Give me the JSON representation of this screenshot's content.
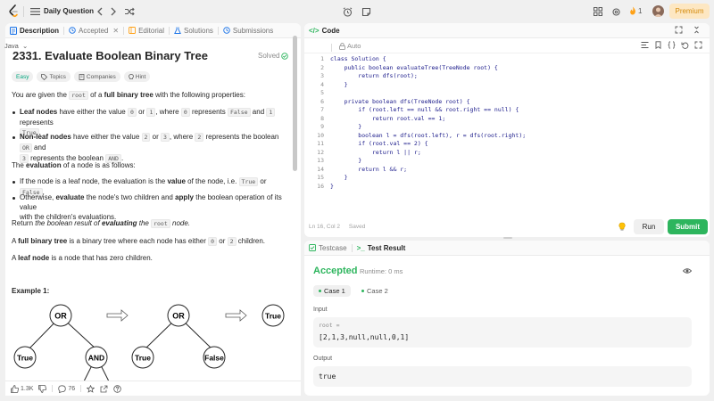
{
  "topbar": {
    "title": "Daily Question",
    "streak_count": "1",
    "premium_label": "Premium"
  },
  "left_tabs": {
    "description": "Description",
    "accepted": "Accepted",
    "editorial": "Editorial",
    "solutions": "Solutions",
    "submissions": "Submissions"
  },
  "problem": {
    "title": "2331. Evaluate Boolean Binary Tree",
    "solved": "Solved",
    "chips": {
      "easy": "Easy",
      "topics": "Topics",
      "companies": "Companies",
      "hint": "Hint"
    },
    "p1": {
      "a": "You are given the ",
      "code": "root",
      "b": " of a ",
      "bold": "full binary tree",
      "c": " with the following properties:"
    },
    "b1": {
      "bold": "Leaf nodes",
      "a": " have either the value ",
      "c0": "0",
      "or": " or ",
      "c1": "1",
      "b": ", where ",
      "c2": "0",
      "r": " represents ",
      "c3": "False",
      "and": " and ",
      "c4": "1",
      "r2": " represents",
      "c5": "True",
      "dot": "."
    },
    "b2": {
      "bold": "Non-leaf nodes",
      "a": " have either the value ",
      "c0": "2",
      "or": " or ",
      "c1": "3",
      "b": ", where ",
      "c2": "2",
      "r": " represents the boolean ",
      "c3": "OR",
      "and": " and",
      "c4": "3",
      "r2": " represents the boolean ",
      "c5": "AND",
      "dot": "."
    },
    "p2": {
      "a": "The ",
      "bold": "evaluation",
      "b": " of a node is as follows:"
    },
    "b3": {
      "a": "If the node is a leaf node, the evaluation is the ",
      "bold": "value",
      "b": " of the node, i.e. ",
      "c0": "True",
      "or": " or ",
      "c1": "False",
      "dot": "."
    },
    "b4": {
      "a": "Otherwise, ",
      "bold1": "evaluate",
      "b": " the node's two children and ",
      "bold2": "apply",
      "c": " the boolean operation of its value",
      "d": "with the children's evaluations."
    },
    "p3": {
      "a": "Return ",
      "i1": "the boolean result of ",
      "bi": "evaluating",
      "i2": " the ",
      "code": "root",
      "i3": " node."
    },
    "p4": {
      "a": "A ",
      "bold": "full binary tree",
      "b": " is a binary tree where each node has either ",
      "c0": "0",
      "or": " or ",
      "c1": "2",
      "c": " children."
    },
    "p5": {
      "a": "A ",
      "bold": "leaf node",
      "b": " is a node that has zero children."
    },
    "example_title": "Example 1:",
    "tree": {
      "n_or1": "OR",
      "n_true1": "True",
      "n_and": "AND",
      "n_or2": "OR",
      "n_true2": "True",
      "n_false": "False",
      "n_true3": "True"
    }
  },
  "left_footer": {
    "likes": "1.3K",
    "comments": "76"
  },
  "code": {
    "tab_title": "Code",
    "language": "Java",
    "auto_label": "Auto",
    "line_numbers": [
      "1",
      "2",
      "3",
      "4",
      "5",
      "6",
      "7",
      "8",
      "9",
      "10",
      "11",
      "12",
      "13",
      "14",
      "15",
      "16"
    ],
    "lines": [
      "class Solution {",
      "    public boolean evaluateTree(TreeNode root) {",
      "        return dfs(root);",
      "    }",
      "",
      "    private boolean dfs(TreeNode root) {",
      "        if (root.left == null && root.right == null) {",
      "            return root.val == 1;",
      "        }",
      "        boolean l = dfs(root.left), r = dfs(root.right);",
      "        if (root.val == 2) {",
      "            return l || r;",
      "        }",
      "        return l && r;",
      "    }",
      "}"
    ],
    "status": "Ln 16, Col 2",
    "saved": "Saved",
    "run_label": "Run",
    "submit_label": "Submit"
  },
  "result": {
    "tab_testcase": "Testcase",
    "tab_result": "Test Result",
    "status": "Accepted",
    "runtime": "Runtime: 0 ms",
    "case1": "Case 1",
    "case2": "Case 2",
    "input_label": "Input",
    "input_var": "root =",
    "input_value": "[2,1,3,null,null,0,1]",
    "output_label": "Output",
    "output_value": "true"
  },
  "colors": {
    "accent_green": "#2db55d",
    "easy": "#00a67e",
    "premium_bg": "#fde7c2",
    "premium_text": "#d48a0a"
  }
}
